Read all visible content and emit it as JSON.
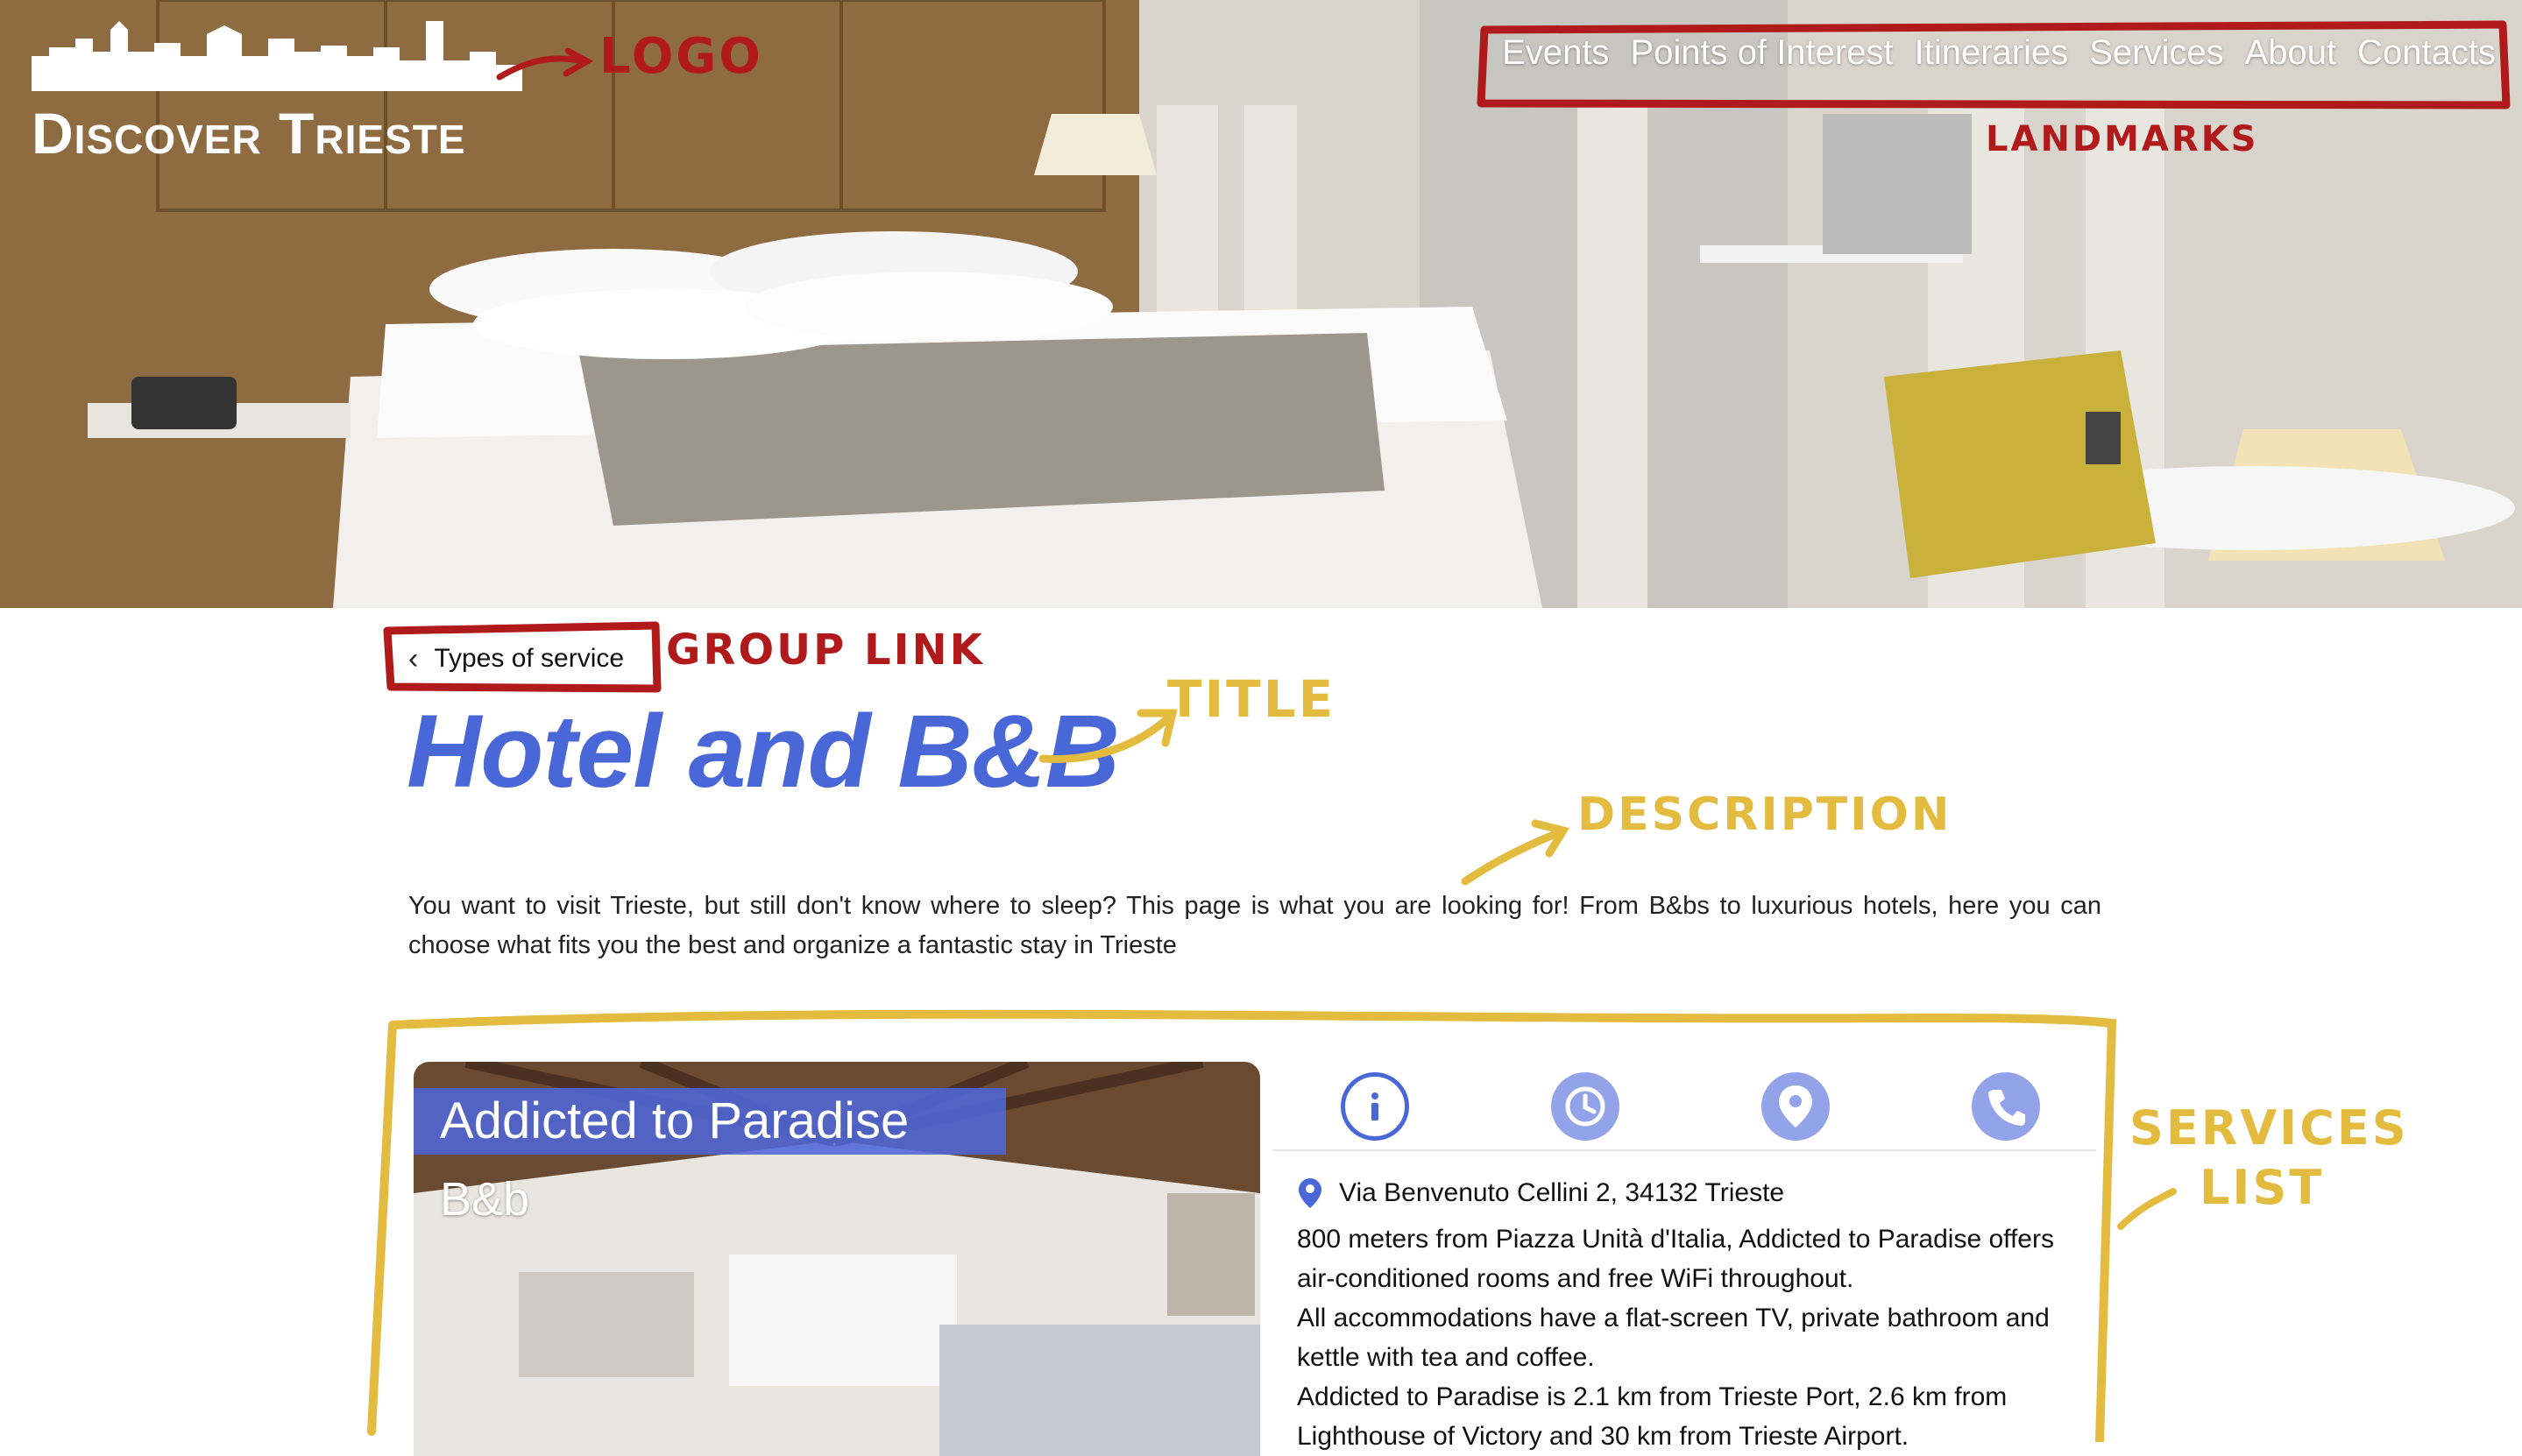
{
  "header": {
    "brand": "Discover Trieste",
    "nav": [
      "Events",
      "Points of Interest",
      "Itineraries",
      "Services",
      "About",
      "Contacts"
    ]
  },
  "annotations": {
    "logo": "LOGO",
    "landmarks": "LANDMARKS",
    "group_link": "GROUP LINK",
    "title": "TITLE",
    "description": "DESCRIPTION",
    "services_list_line1": "SERVICES",
    "services_list_line2": "LIST"
  },
  "breadcrumb": {
    "label": "Types of service"
  },
  "page": {
    "title": "Hotel and B&B",
    "description": "You want to visit Trieste, but still don't know where to sleep? This page is what you are looking for! From B&bs to luxurious hotels, here you can choose what fits you the best and organize a fantastic stay in Trieste"
  },
  "service": {
    "name": "Addicted to Paradise",
    "type": "B&b",
    "tabs": [
      {
        "icon": "info-icon",
        "active": true
      },
      {
        "icon": "clock-icon",
        "active": false
      },
      {
        "icon": "map-pin-icon",
        "active": false
      },
      {
        "icon": "phone-icon",
        "active": false
      }
    ],
    "address": "Via Benvenuto Cellini 2, 34132 Trieste",
    "details": [
      "800 meters from Piazza Unità d'Italia, Addicted to Paradise offers air-conditioned rooms and free WiFi throughout.",
      "All accommodations have a flat-screen TV, private bathroom and kettle with tea and coffee.",
      "Addicted to Paradise is 2.1 km from Trieste Port, 2.6 km from Lighthouse of Victory and 30 km from Trieste Airport."
    ]
  },
  "colors": {
    "accent": "#4a67d8",
    "accent_light": "#93a3e9",
    "annotation_red": "#b01a1a",
    "annotation_yellow": "#e2bb3f"
  }
}
